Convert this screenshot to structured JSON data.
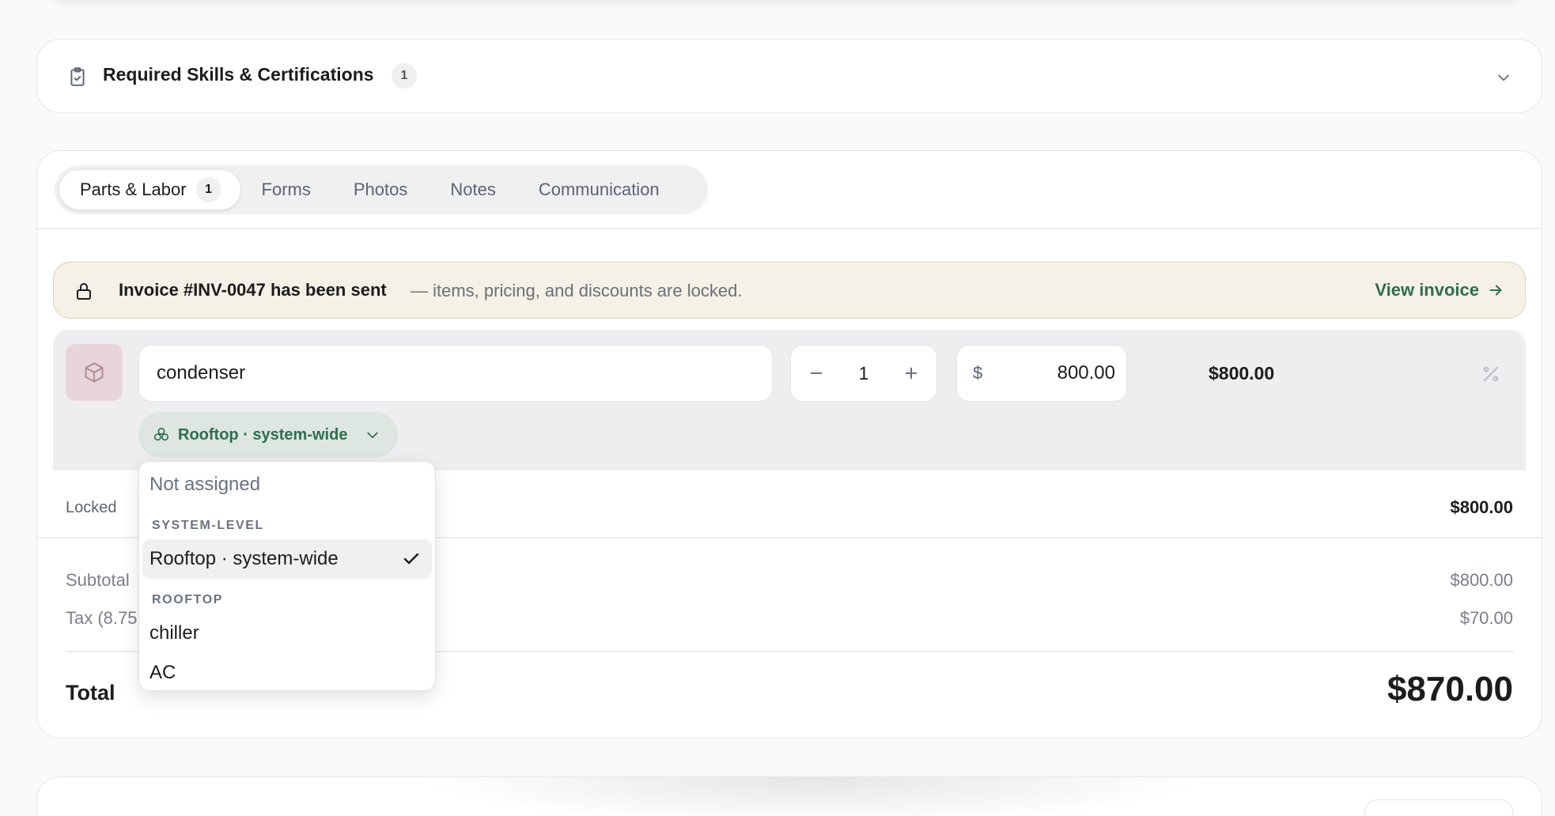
{
  "skills": {
    "title": "Required Skills & Certifications",
    "count": "1"
  },
  "tabs": [
    {
      "label": "Parts & Labor",
      "count": "1",
      "active": true
    },
    {
      "label": "Forms"
    },
    {
      "label": "Photos"
    },
    {
      "label": "Notes"
    },
    {
      "label": "Communication"
    }
  ],
  "banner": {
    "title": "Invoice #INV-0047 has been sent",
    "message": "— items, pricing, and discounts are locked.",
    "link": "View invoice"
  },
  "line_item": {
    "name": "condenser",
    "quantity": "1",
    "currency": "$",
    "unit_price": "800.00",
    "line_total": "$800.00",
    "assignment": "Rooftop · system-wide"
  },
  "dropdown": {
    "placeholder": "Not assigned",
    "groups": [
      {
        "label": "SYSTEM-LEVEL",
        "items": [
          {
            "label": "Rooftop · system-wide",
            "selected": true
          }
        ]
      },
      {
        "label": "ROOFTOP",
        "items": [
          {
            "label": "chiller"
          },
          {
            "label": "AC"
          }
        ]
      }
    ]
  },
  "summary": {
    "locked_label": "Locked",
    "locked_amount": "$800.00",
    "subtotal_label": "Subtotal",
    "subtotal_amount": "$800.00",
    "tax_label": "Tax (8.75",
    "tax_amount": "$70.00",
    "total_label": "Total",
    "total_amount": "$870.00"
  },
  "colors": {
    "accent_green": "#2f6e4b",
    "banner_bg": "#f5f1e6",
    "thumb_bg": "#e8d5dc"
  }
}
